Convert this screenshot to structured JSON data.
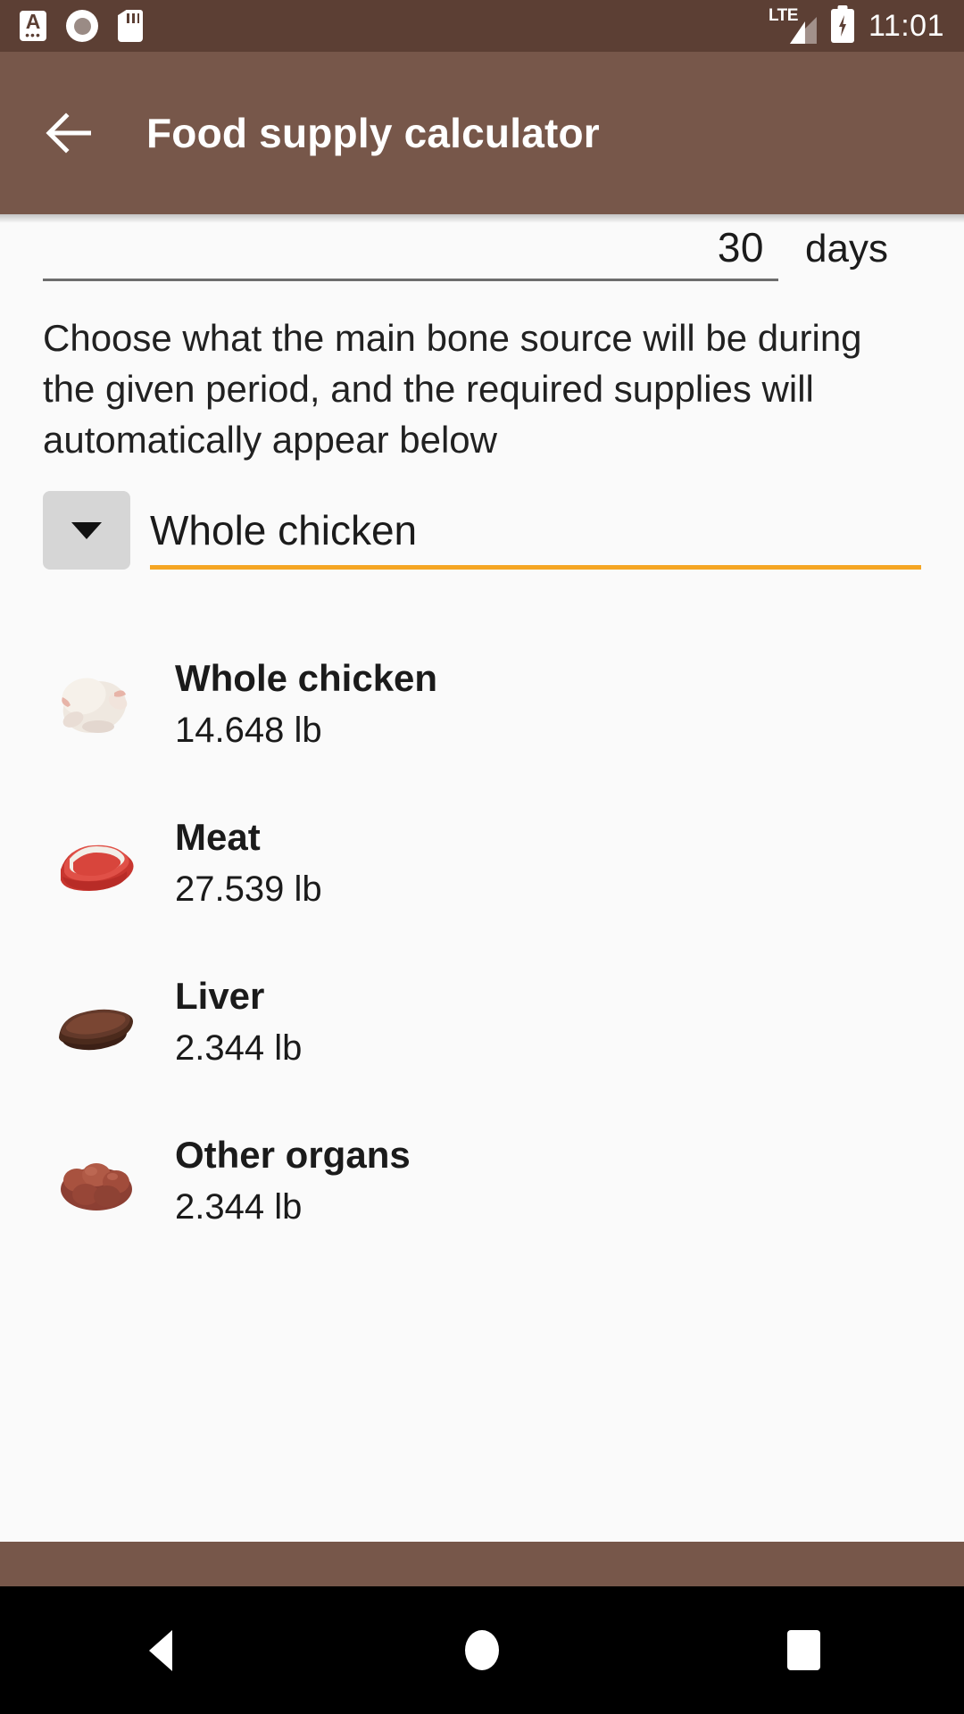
{
  "status_bar": {
    "icons": [
      "keyboard-icon",
      "disc-icon",
      "sd-card-icon"
    ],
    "keyboard_glyph": "A",
    "keyboard_dots": "•••",
    "network_label": "LTE",
    "battery": "charging",
    "time": "11:01"
  },
  "app_bar": {
    "back_label": "back-arrow",
    "title": "Food supply calculator",
    "background": "#77574a"
  },
  "days_input": {
    "value": "30",
    "placeholder": "30",
    "unit": "days"
  },
  "helper_text": "Choose what the main bone source will be during the given period, and the required supplies will automatically appear below",
  "spinner": {
    "selected": "Whole chicken",
    "caret": "chevron-down-icon",
    "underline_color": "#f5a623",
    "options": [
      "Whole chicken"
    ]
  },
  "results": [
    {
      "name": "Whole chicken",
      "amount": "14.648 lb",
      "thumb": "whole-chicken-image"
    },
    {
      "name": "Meat",
      "amount": "27.539 lb",
      "thumb": "meat-steak-image"
    },
    {
      "name": "Liver",
      "amount": "2.344 lb",
      "thumb": "liver-image"
    },
    {
      "name": "Other organs",
      "amount": "2.344 lb",
      "thumb": "organs-image"
    }
  ],
  "nav_bar": {
    "back": "back-triangle-icon",
    "home": "home-circle-icon",
    "recents": "recents-square-icon"
  }
}
